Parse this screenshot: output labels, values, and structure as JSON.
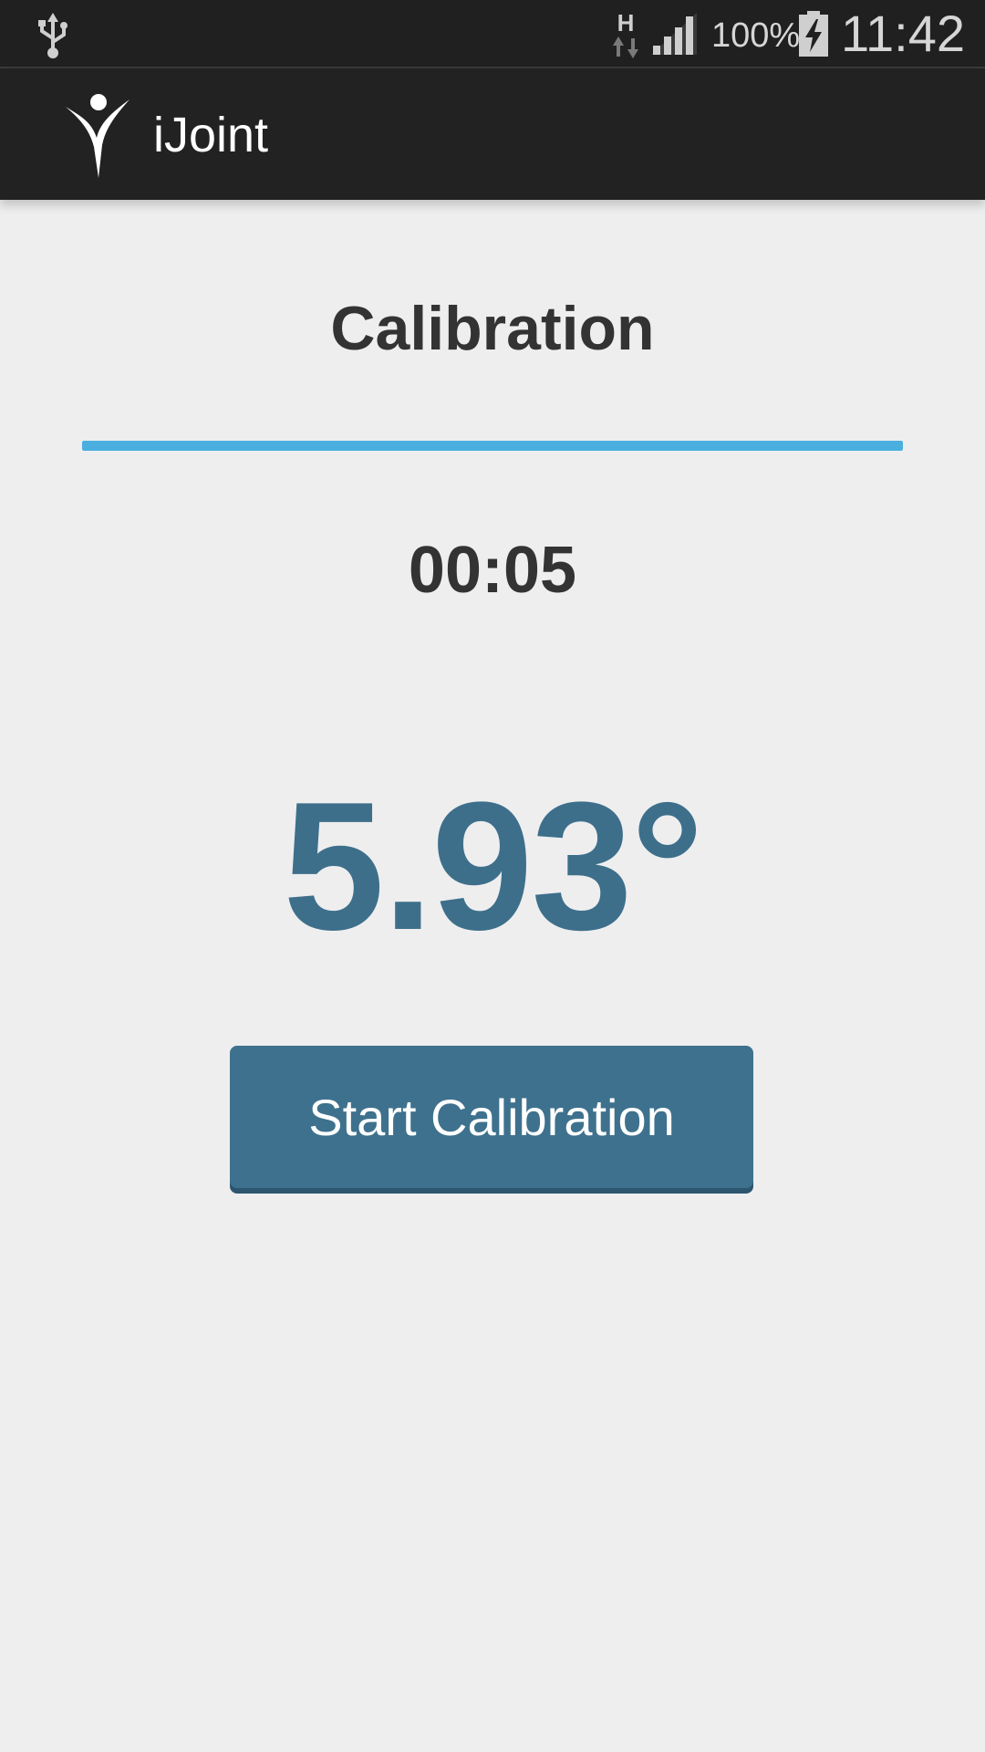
{
  "status_bar": {
    "usb_icon": "usb-icon",
    "network_type": "H",
    "signal_icon": "signal-icon",
    "battery_percent": "100%",
    "battery_icon": "battery-charging-icon",
    "time": "11:42"
  },
  "action_bar": {
    "logo_icon": "ijoint-logo-icon",
    "title": "iJoint"
  },
  "main": {
    "title": "Calibration",
    "progress_fraction": 1.0,
    "timer": "00:05",
    "angle": "5.93°",
    "start_button_label": "Start Calibration"
  },
  "colors": {
    "status_bar_bg": "#202020",
    "action_bar_bg": "#222222",
    "page_bg": "#eeeeef",
    "progress": "#4aafdf",
    "accent": "#3e718d",
    "text_dark": "#333333"
  }
}
